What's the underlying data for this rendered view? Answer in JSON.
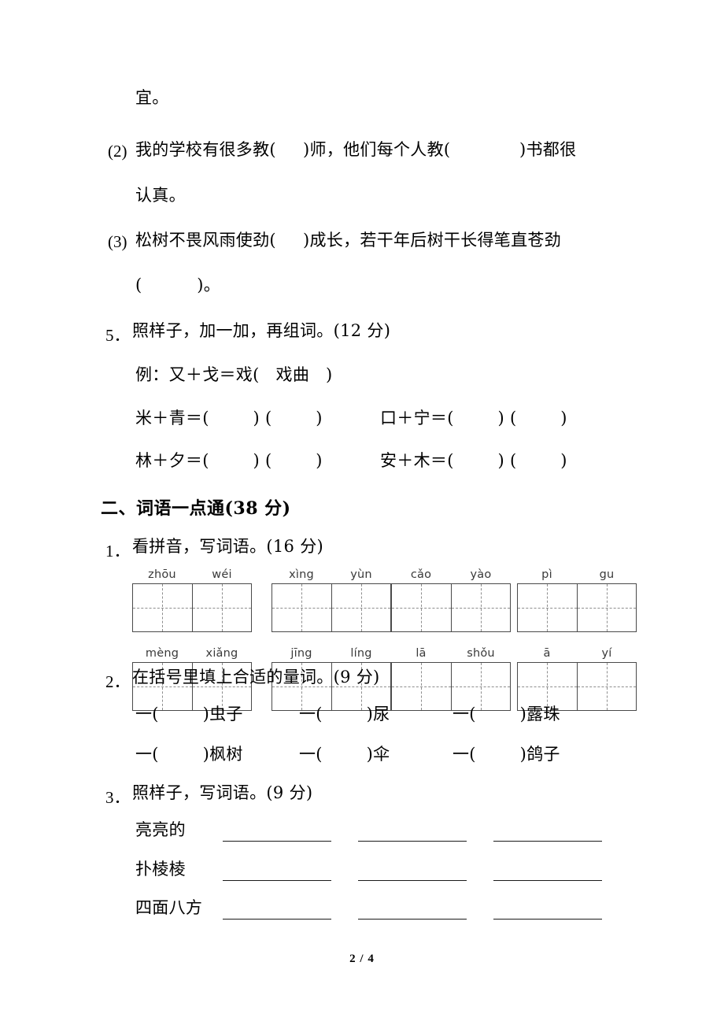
{
  "document": {
    "footer_page": "2 / 4"
  },
  "section_one_continued": {
    "orphan_line": "宜。",
    "items": [
      {
        "number": "(2)",
        "line1_before": "我的学校有很多教(",
        "line1_middle": ")师，他们每个人教(",
        "line1_after": ")书都很",
        "line2": "认真。"
      },
      {
        "number": "(3)",
        "line1_before": "松树不畏风雨使劲(",
        "line1_after": ")成长，若干年后树干长得笔直苍劲",
        "line2": "(          )。"
      }
    ],
    "q5": {
      "number": "5．",
      "prompt": "照样子，加一加，再组词。(12 分)",
      "example": "例：又＋戈＝戏(   戏曲   )",
      "rows": [
        {
          "left": "米＋青＝(        ) (        )",
          "right": "口＋宁＝(        ) (        )"
        },
        {
          "left": "林＋夕＝(        ) (        )",
          "right": "安＋木＝(        ) (        )"
        }
      ]
    }
  },
  "section_two": {
    "heading": "二、词语一点通(38 分)",
    "q1": {
      "number": "1．",
      "prompt": "看拼音，写词语。(16 分)",
      "rows": [
        [
          {
            "syllables": [
              "zhōu",
              "wéi"
            ]
          },
          {
            "syllables": [
              "xìng",
              "yùn"
            ]
          },
          {
            "syllables": [
              "cǎo",
              "yào"
            ]
          },
          {
            "syllables": [
              "pì",
              "gu"
            ]
          }
        ],
        [
          {
            "syllables": [
              "mèng",
              "xiǎng"
            ]
          },
          {
            "syllables": [
              "jīng",
              "líng"
            ]
          },
          {
            "syllables": [
              "lā",
              "shǒu"
            ]
          },
          {
            "syllables": [
              "ā",
              "yí"
            ]
          }
        ]
      ]
    },
    "q2": {
      "number": "2．",
      "prompt": "在括号里填上合适的量词。(9 分)",
      "rows": [
        [
          "一(        )虫子",
          "一(        )尿",
          "一(        )露珠"
        ],
        [
          "一(        )枫树",
          "一(        )伞",
          "一(        )鸽子"
        ]
      ]
    },
    "q3": {
      "number": "3．",
      "prompt": "照样子，写词语。(9 分)",
      "rows": [
        {
          "sample": "亮亮的",
          "blanks": 3
        },
        {
          "sample": "扑棱棱",
          "blanks": 3
        },
        {
          "sample": "四面八方",
          "blanks": 3
        }
      ]
    }
  }
}
